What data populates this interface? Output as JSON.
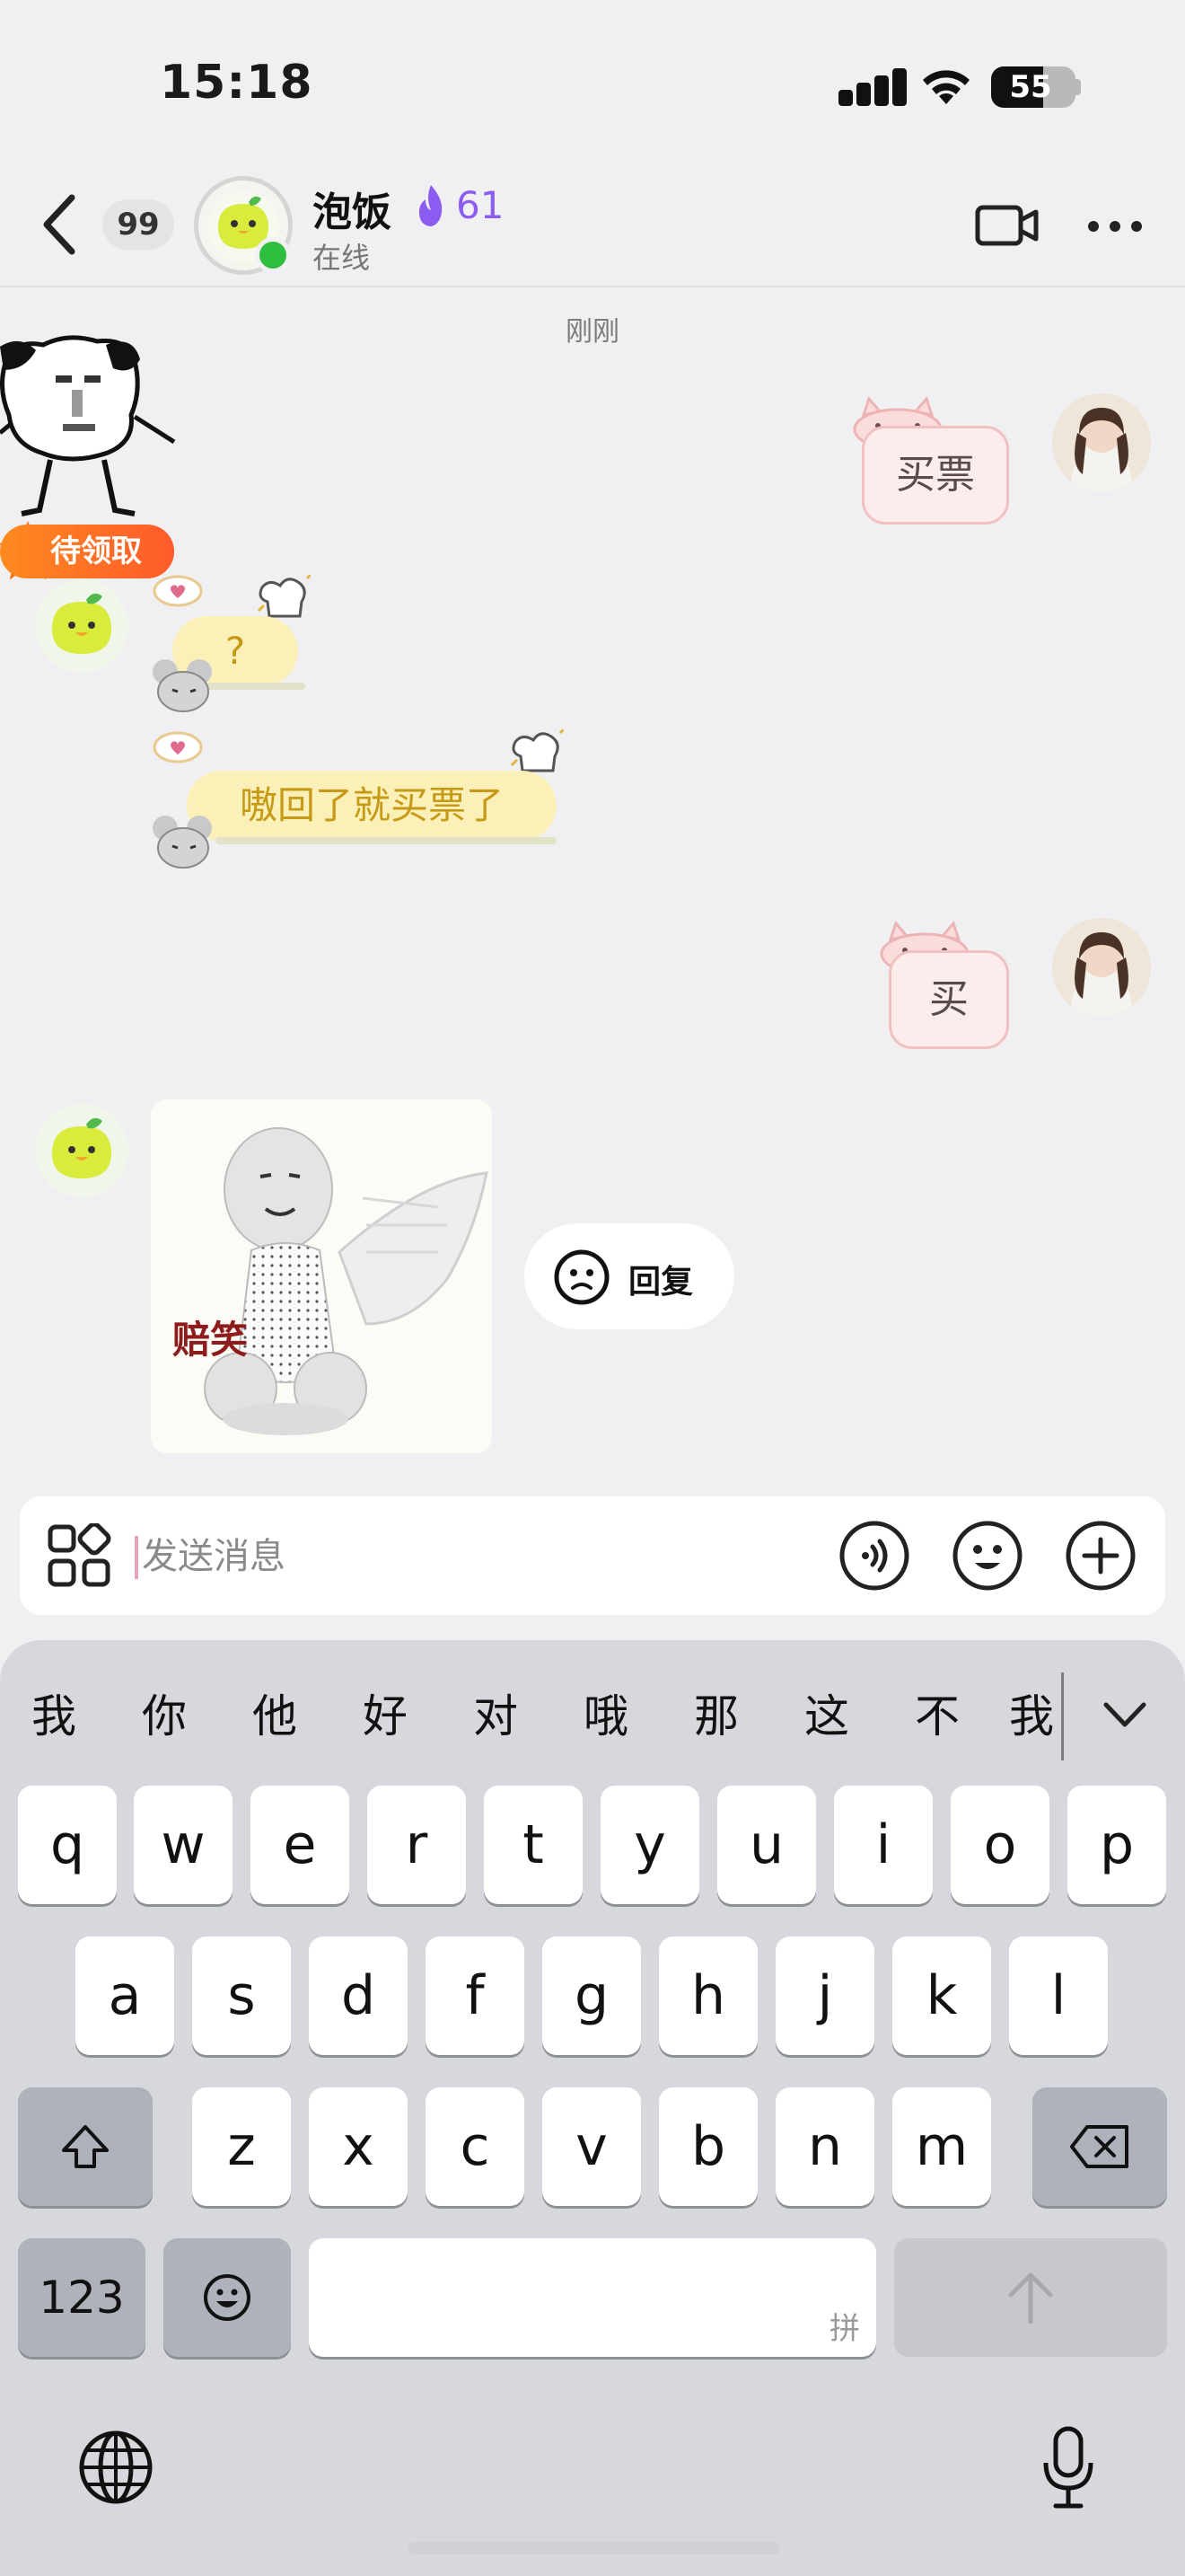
{
  "status_bar": {
    "time": "15:18",
    "battery": "55"
  },
  "header": {
    "unread_count": "99",
    "contact_name": "泡饭",
    "streak": "61",
    "status": "在线"
  },
  "chat": {
    "time_label": "刚刚",
    "claim_badge": "待领取",
    "messages": [
      {
        "sender": "me",
        "text": "买票"
      },
      {
        "sender": "peer",
        "text": "?"
      },
      {
        "sender": "peer",
        "text": "嗷回了就买票了"
      },
      {
        "sender": "me",
        "text": "买"
      },
      {
        "sender": "peer",
        "type": "sticker",
        "caption": "赔笑"
      }
    ],
    "reply_button": "回复"
  },
  "composer": {
    "placeholder": "发送消息"
  },
  "keyboard": {
    "candidates": [
      "我",
      "你",
      "他",
      "好",
      "对",
      "哦",
      "那",
      "这",
      "不",
      "我"
    ],
    "row1": [
      "q",
      "w",
      "e",
      "r",
      "t",
      "y",
      "u",
      "i",
      "o",
      "p"
    ],
    "row2": [
      "a",
      "s",
      "d",
      "f",
      "g",
      "h",
      "j",
      "k",
      "l"
    ],
    "row3": [
      "z",
      "x",
      "c",
      "v",
      "b",
      "n",
      "m"
    ],
    "numbers_key": "123",
    "space_hint": "拼"
  },
  "colors": {
    "streak": "#8a5cf0",
    "online": "#2fbf3e",
    "bubble_text": "#c69a16",
    "claim": "#ff6a22"
  }
}
